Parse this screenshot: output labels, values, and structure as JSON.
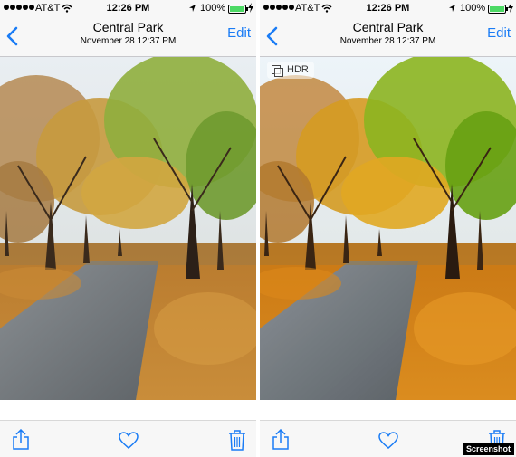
{
  "status": {
    "carrier": "AT&T",
    "time": "12:26 PM",
    "battery": "100%",
    "battery_level": 1.0
  },
  "nav": {
    "title": "Central Park",
    "subtitle": "November 28  12:37 PM",
    "edit_label": "Edit",
    "back_icon": "chevron-left-icon"
  },
  "badge": {
    "hdr_label": "HDR"
  },
  "toolbar": {
    "share_icon": "share-icon",
    "favorite_icon": "heart-icon",
    "delete_icon": "trash-icon"
  },
  "colors": {
    "accent": "#1a7cf5",
    "battery": "#4cd964"
  },
  "watermark": "Screenshot"
}
